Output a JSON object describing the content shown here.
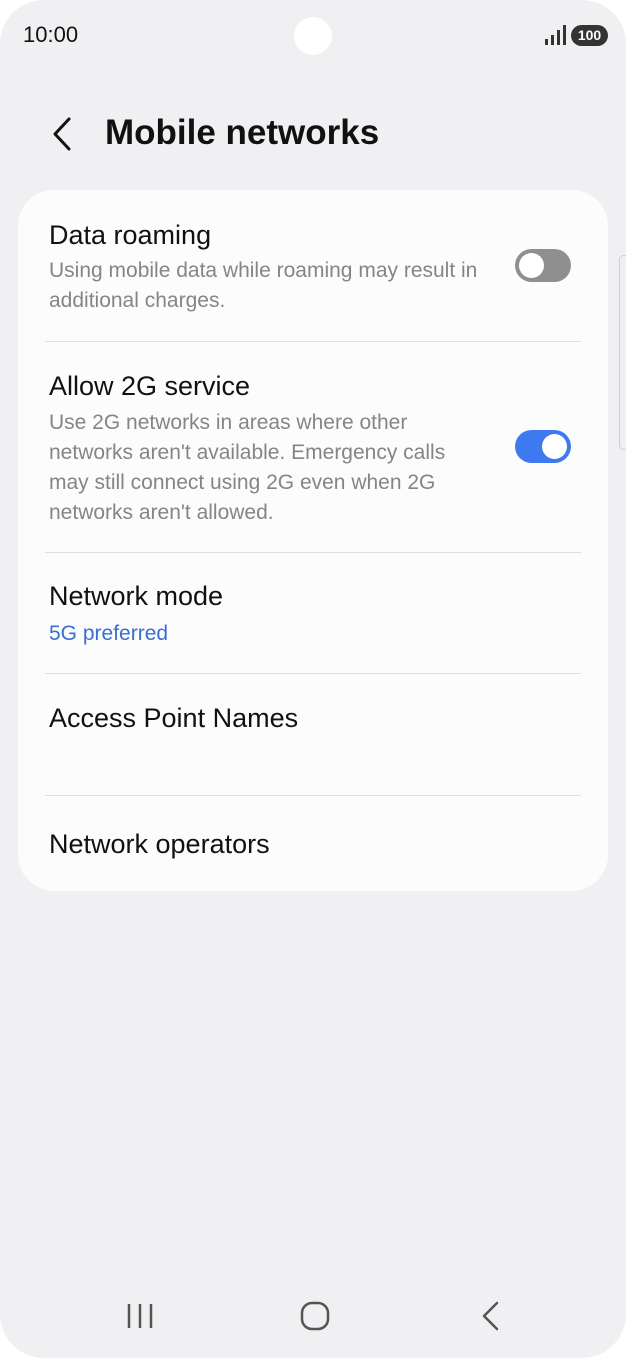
{
  "status_bar": {
    "time": "10:00",
    "battery": "100",
    "signal_icon": "signal-bars-icon"
  },
  "header": {
    "back_icon": "chevron-left-icon",
    "title": "Mobile networks"
  },
  "settings": {
    "data_roaming": {
      "title": "Data roaming",
      "description": "Using mobile data while roaming may result in additional charges.",
      "enabled": false
    },
    "allow_2g": {
      "title": "Allow 2G service",
      "description": "Use 2G networks in areas where other networks aren't available. Emergency calls may still connect using 2G even when 2G networks aren't allowed.",
      "enabled": true
    },
    "network_mode": {
      "title": "Network mode",
      "value": "5G preferred"
    },
    "access_point_names": {
      "title": "Access Point Names"
    },
    "network_operators": {
      "title": "Network operators"
    }
  },
  "nav_bar": {
    "recents_icon": "recents-icon",
    "home_icon": "home-icon",
    "back_icon": "back-chevron-icon"
  },
  "colors": {
    "background": "#f0f0f2",
    "card": "#fcfcfd",
    "accent": "#3e79f0",
    "link_text": "#3a6fd0",
    "toggle_off": "#8f8f8f"
  }
}
